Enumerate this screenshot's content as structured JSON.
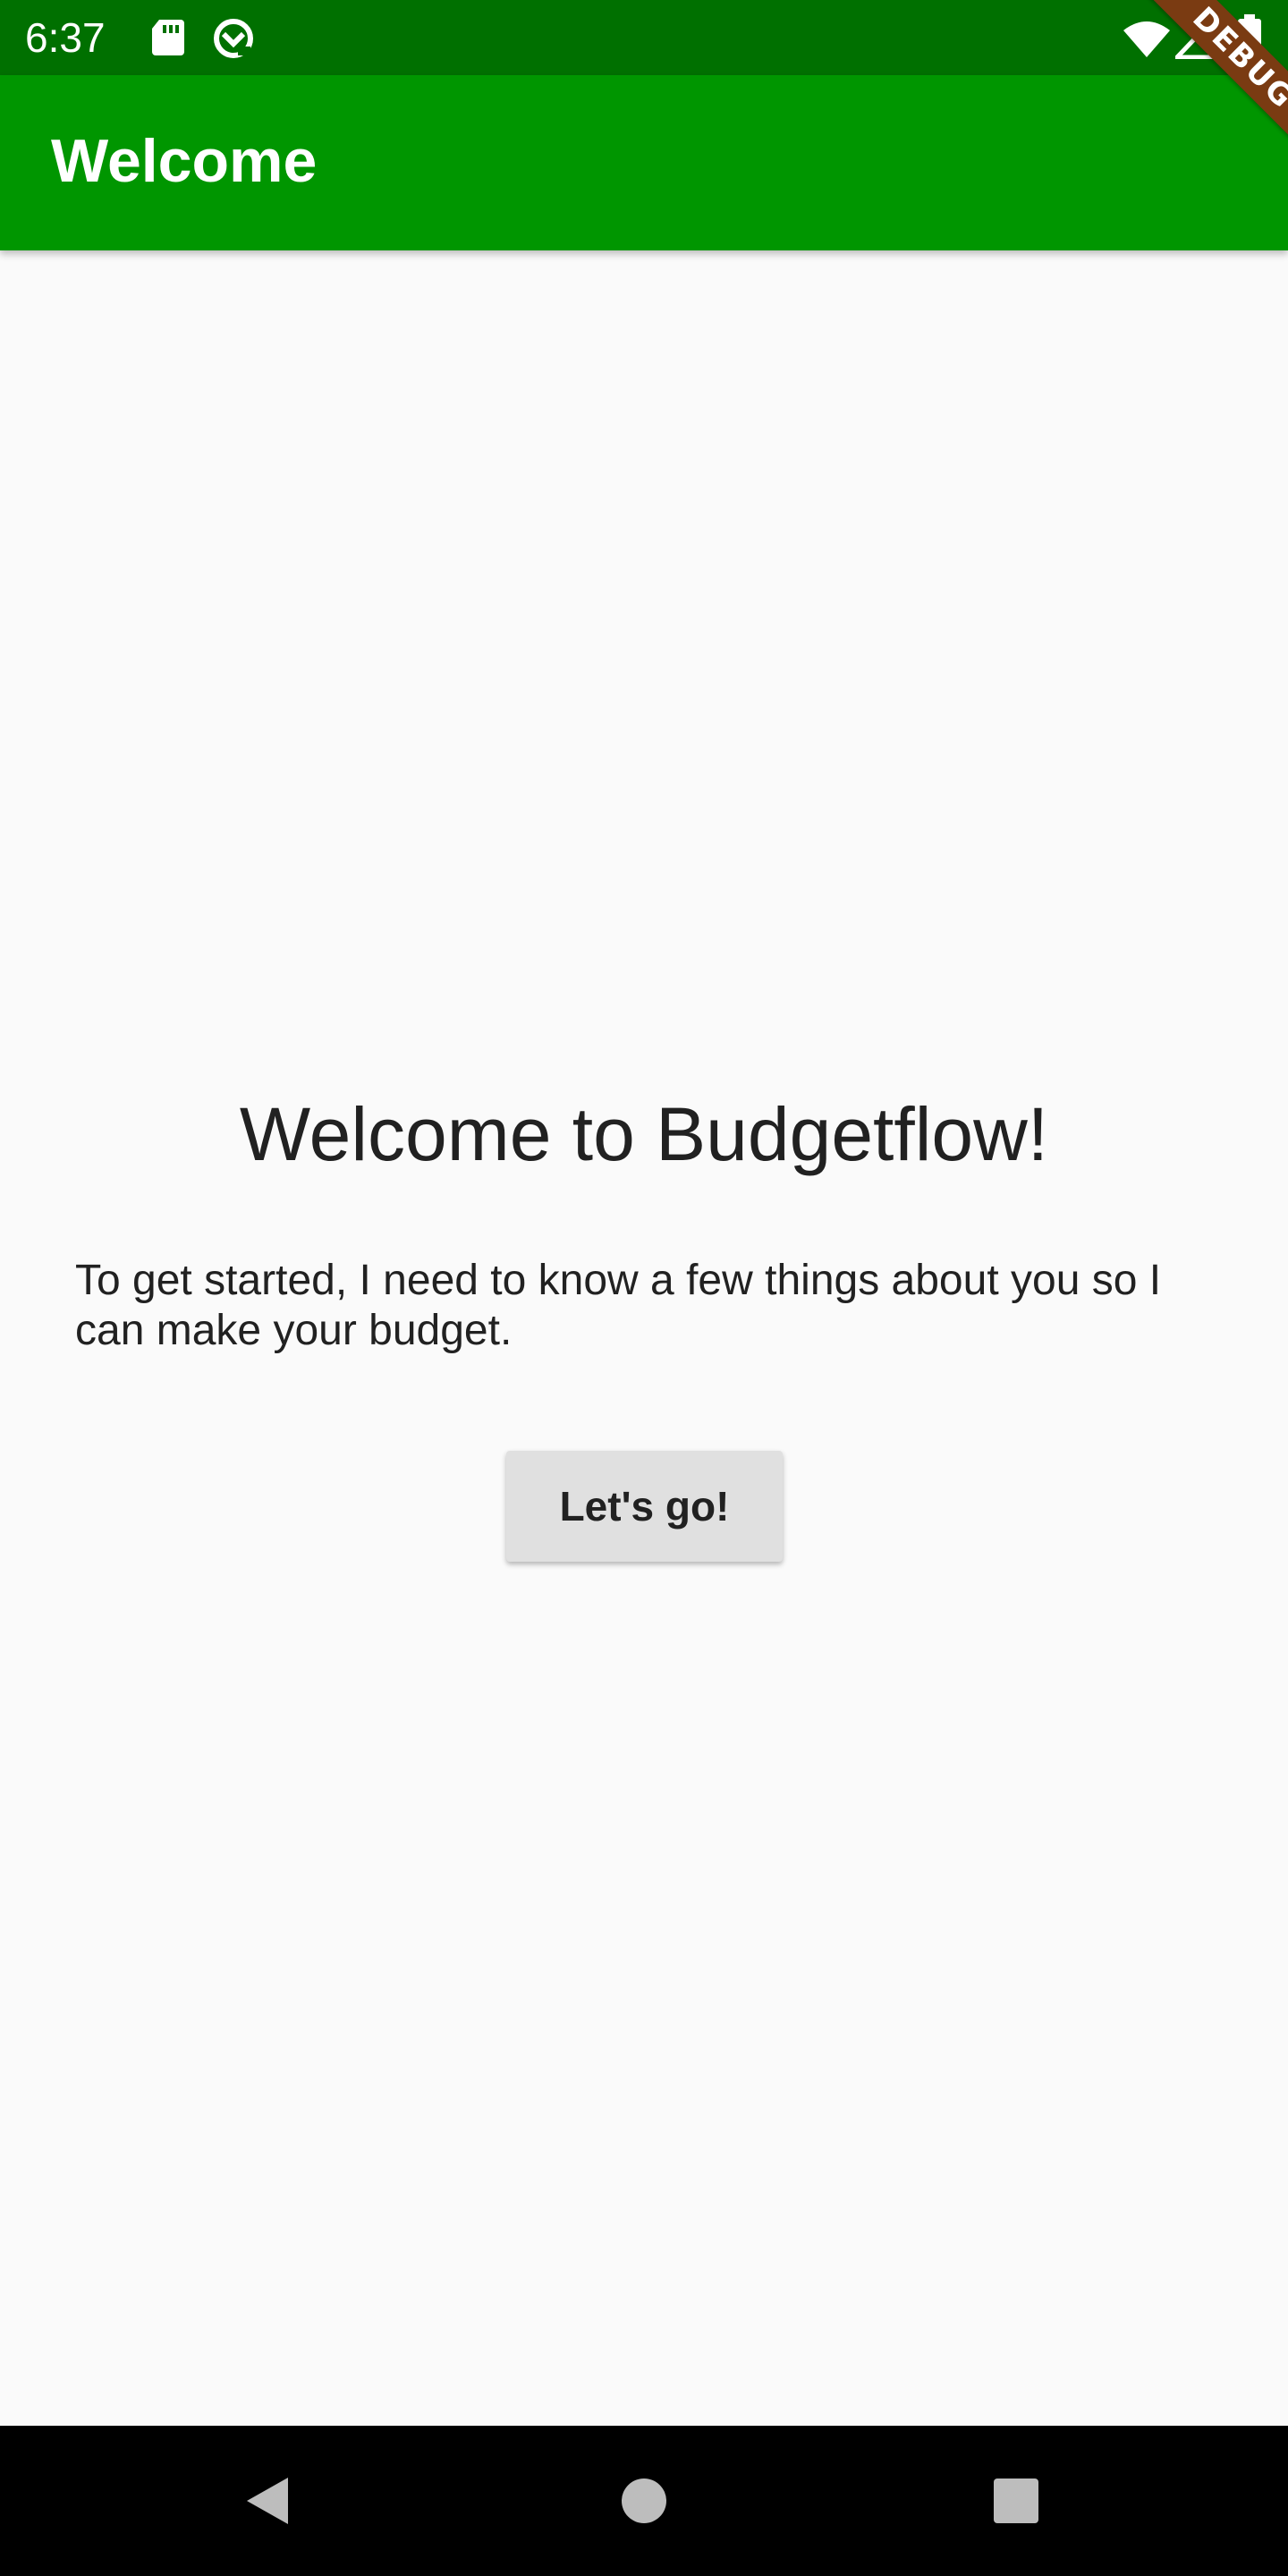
{
  "status_bar": {
    "time": "6:37",
    "icons": [
      "sd-card-icon",
      "data-saver-icon",
      "wifi-icon",
      "cell-signal-icon",
      "battery-icon"
    ],
    "background": "#007000"
  },
  "debug_banner": {
    "label": "DEBUG",
    "color": "#7a3b12"
  },
  "app_bar": {
    "title": "Welcome",
    "background": "#009600"
  },
  "main": {
    "heading": "Welcome to Budgetflow!",
    "body": "To get started, I need to know a few things about you so I can make your budget.",
    "button_label": "Let's go!"
  },
  "nav_bar": {
    "buttons": [
      "back-icon",
      "home-icon",
      "recents-icon"
    ]
  }
}
